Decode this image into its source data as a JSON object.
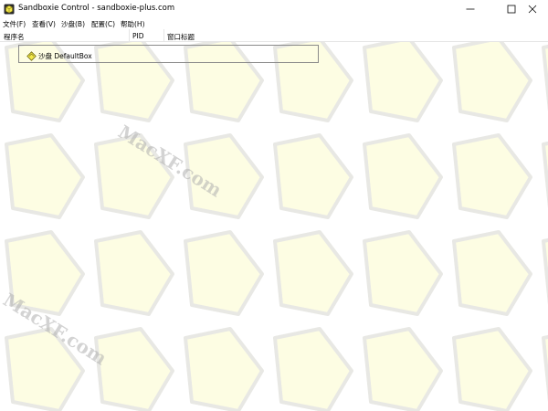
{
  "window": {
    "title": "Sandboxie Control - sandboxie-plus.com",
    "app_icon": "sandboxie-logo-icon",
    "controls": [
      "minimize-icon",
      "maximize-icon",
      "close-icon"
    ]
  },
  "menubar": {
    "items": [
      {
        "label": "文件(F)"
      },
      {
        "label": "查看(V)"
      },
      {
        "label": "沙盘(B)"
      },
      {
        "label": "配置(C)"
      },
      {
        "label": "帮助(H)"
      }
    ]
  },
  "list": {
    "columns": [
      {
        "label": "程序名"
      },
      {
        "label": "PID"
      },
      {
        "label": "窗口标题"
      }
    ],
    "rows": [
      {
        "label": "沙盘 DefaultBox",
        "icon": "sandbox-icon"
      }
    ]
  },
  "watermark": {
    "text1": "MacXF.com",
    "text2": "MacXF.com"
  },
  "colors": {
    "pattern_fill": "#fdfde3",
    "pattern_stroke": "#e8e8e4",
    "sandbox_icon": "#f2e84a"
  }
}
